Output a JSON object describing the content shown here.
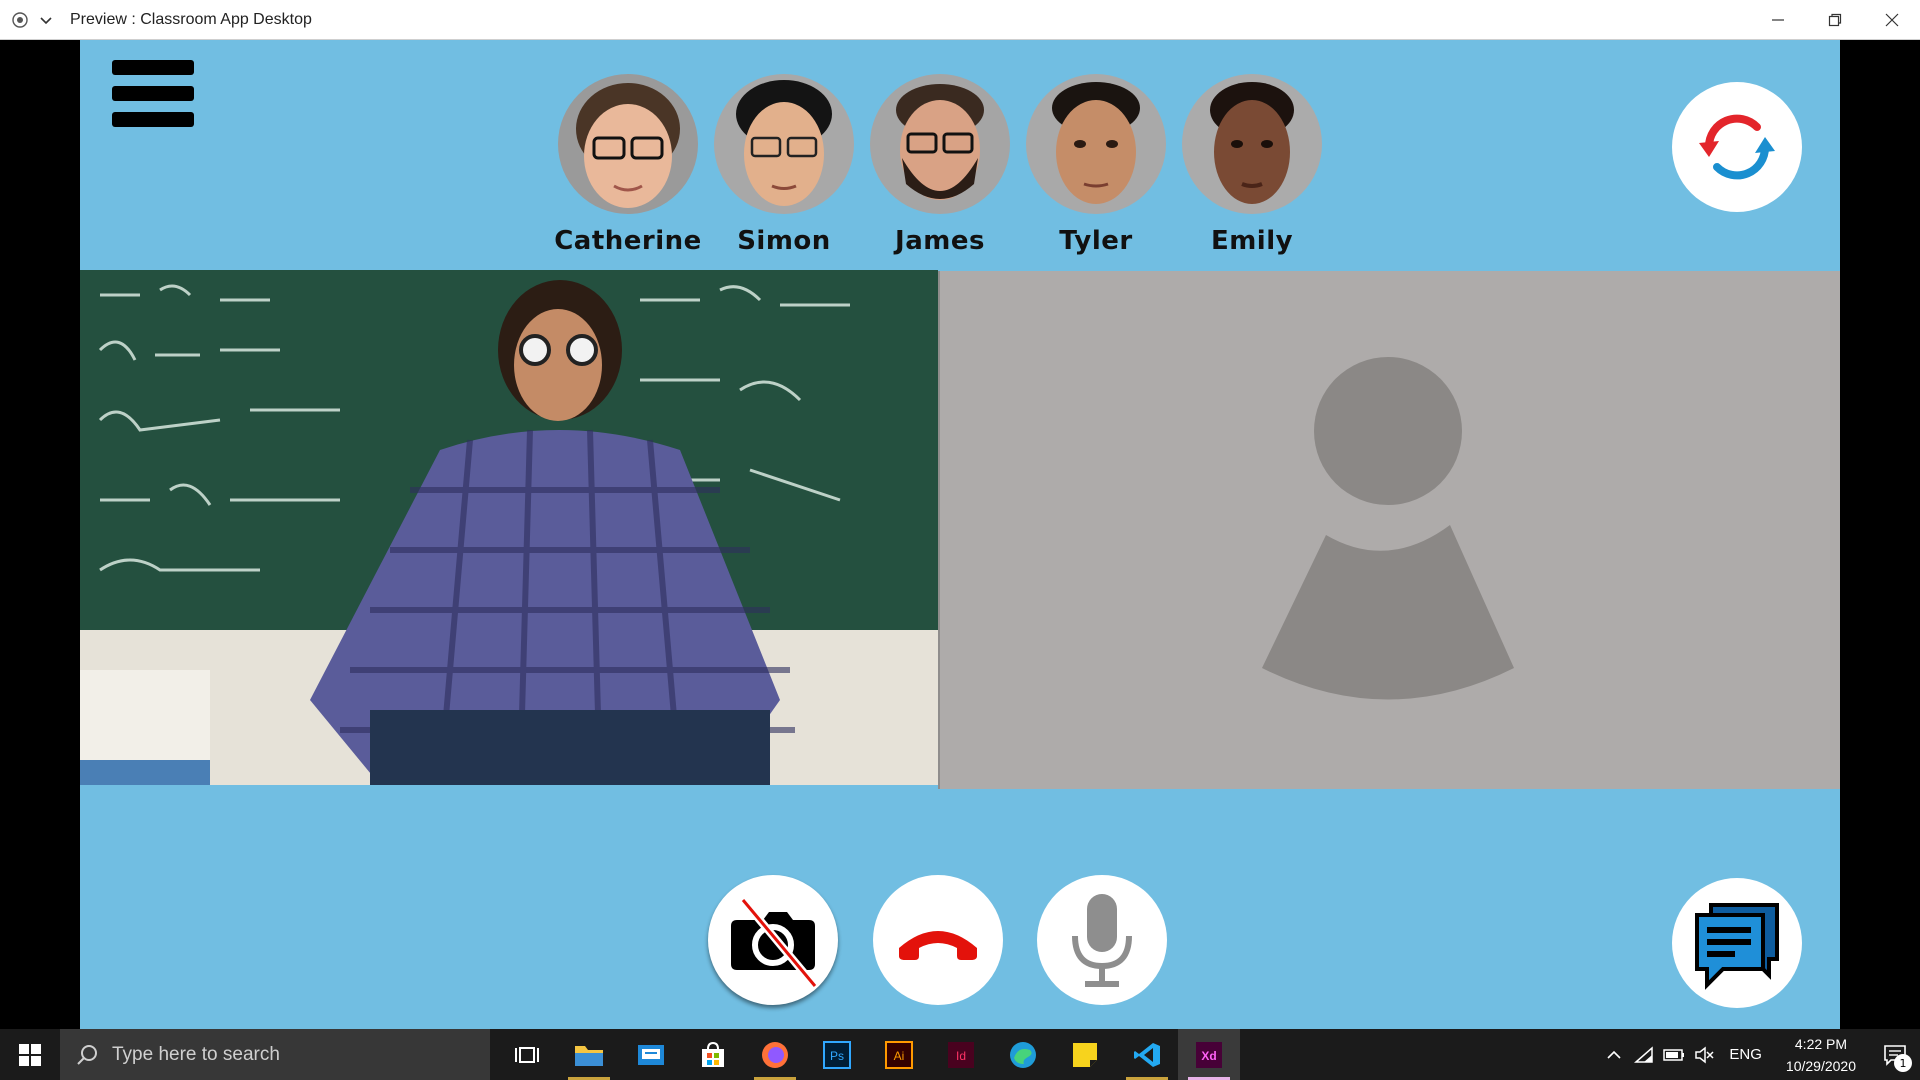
{
  "window": {
    "title": "Preview : Classroom App Desktop"
  },
  "participants": [
    {
      "name": "Catherine",
      "skin": "#e9b89a",
      "hair": "#4a3526"
    },
    {
      "name": "Simon",
      "skin": "#e2b08c",
      "hair": "#141414"
    },
    {
      "name": "James",
      "skin": "#d9a285",
      "hair": "#3a2a20"
    },
    {
      "name": "Tyler",
      "skin": "#c58d68",
      "hair": "#1a1410"
    },
    {
      "name": "Emily",
      "skin": "#7a4a34",
      "hair": "#1c120e"
    }
  ],
  "controls": {
    "camera_state": "off",
    "mic_state": "muted"
  },
  "colors": {
    "app_background": "#71bee2",
    "peer_background": "#aeabaa",
    "placeholder_silhouette": "#8b8886",
    "hangup_red": "#e3120b",
    "sync_red": "#e3252b",
    "sync_blue": "#1a8fd0",
    "chat_blue": "#1f6fb5"
  },
  "taskbar": {
    "search_placeholder": "Type here to search",
    "apps": [
      {
        "name": "task-view",
        "label": "Task View"
      },
      {
        "name": "file-explorer",
        "label": "File Explorer"
      },
      {
        "name": "outlook",
        "label": "Mail"
      },
      {
        "name": "microsoft-store",
        "label": "Microsoft Store"
      },
      {
        "name": "firefox",
        "label": "Firefox"
      },
      {
        "name": "photoshop",
        "label": "Ps"
      },
      {
        "name": "illustrator",
        "label": "Ai"
      },
      {
        "name": "indesign",
        "label": "Id"
      },
      {
        "name": "edge",
        "label": "Edge"
      },
      {
        "name": "sticky-notes",
        "label": "Sticky Notes"
      },
      {
        "name": "vscode",
        "label": "VS Code"
      },
      {
        "name": "adobe-xd",
        "label": "Xd"
      }
    ],
    "language": "ENG",
    "time": "4:22 PM",
    "date": "10/29/2020",
    "notification_count": "1"
  }
}
